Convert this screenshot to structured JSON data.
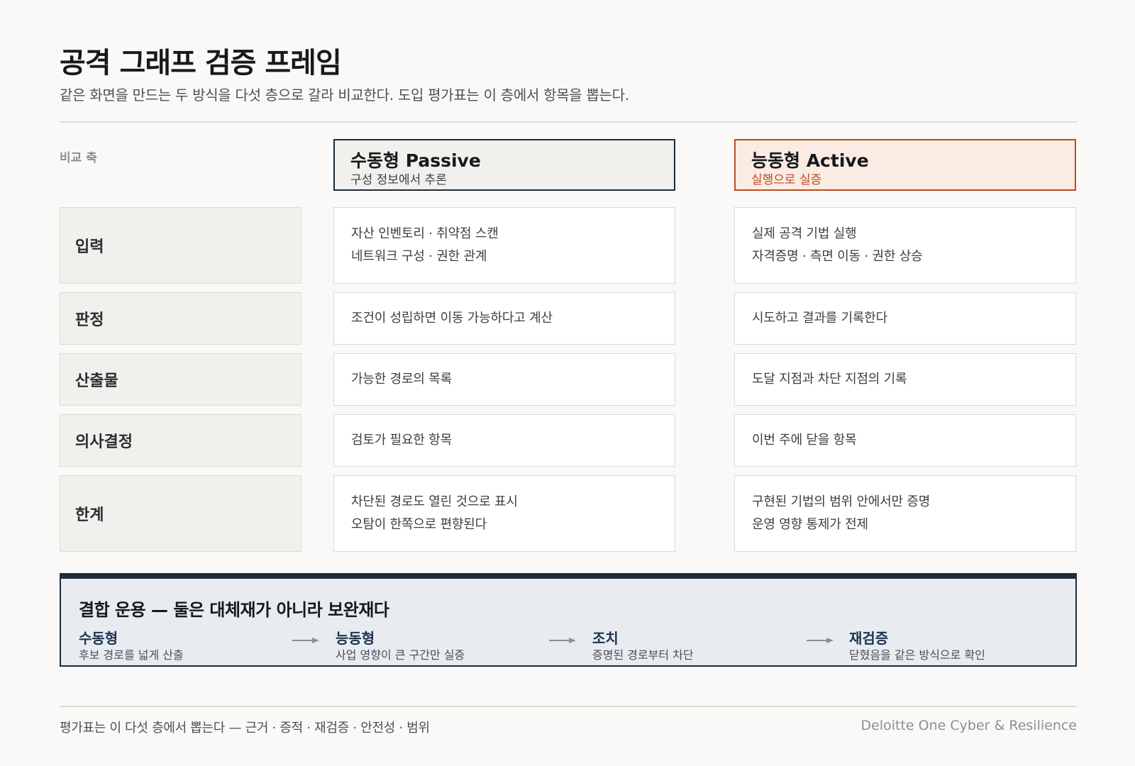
{
  "header": {
    "title": "공격 그래프 검증 프레임",
    "subtitle": "같은 화면을 만드는 두 방식을 다섯 층으로 갈라 비교한다. 도입 평가표는 이 층에서 항목을 뽑는다."
  },
  "comparison": {
    "axis_label": "비교 축",
    "passive": {
      "title": "수동형  Passive",
      "subtitle": "구성 정보에서 추론"
    },
    "active": {
      "title": "능동형  Active",
      "subtitle": "실행으로 실증"
    },
    "rows": [
      {
        "label": "입력",
        "passive": [
          "자산 인벤토리 · 취약점 스캔",
          "네트워크 구성 · 권한 관계"
        ],
        "active": [
          "실제 공격 기법 실행",
          "자격증명 · 측면 이동 · 권한 상승"
        ]
      },
      {
        "label": "판정",
        "passive": [
          "조건이 성립하면 이동 가능하다고 계산"
        ],
        "active": [
          "시도하고 결과를 기록한다"
        ]
      },
      {
        "label": "산출물",
        "passive": [
          "가능한 경로의 목록"
        ],
        "active": [
          "도달 지점과 차단 지점의 기록"
        ]
      },
      {
        "label": "의사결정",
        "passive": [
          "검토가 필요한 항목"
        ],
        "active": [
          "이번 주에 닫을 항목"
        ]
      },
      {
        "label": "한계",
        "passive": [
          "차단된 경로도 열린 것으로 표시",
          "오탐이 한쪽으로 편향된다"
        ],
        "active": [
          "구현된 기법의 범위 안에서만 증명",
          "운영 영향 통제가 전제"
        ]
      }
    ]
  },
  "combined": {
    "title": "결합 운용 — 둘은 대체재가 아니라 보완재다",
    "steps": [
      {
        "name": "수동형",
        "desc": "후보 경로를 넓게 산출"
      },
      {
        "name": "능동형",
        "desc": "사업 영향이 큰 구간만 실증"
      },
      {
        "name": "조치",
        "desc": "증명된 경로부터 차단"
      },
      {
        "name": "재검증",
        "desc": "닫혔음을 같은 방식으로 확인"
      }
    ]
  },
  "footer": {
    "note": "평가표는 이 다섯 층에서 뽑는다 — 근거 · 증적 · 재검증 · 안전성 · 범위",
    "brand": "Deloitte One Cyber & Resilience"
  },
  "colors": {
    "navy": "#1e2c3c",
    "accent": "#bf4a22",
    "passive_bg": "#f1f0ec",
    "active_bg": "#faebe3",
    "combined_bg": "#e8ecf0"
  }
}
